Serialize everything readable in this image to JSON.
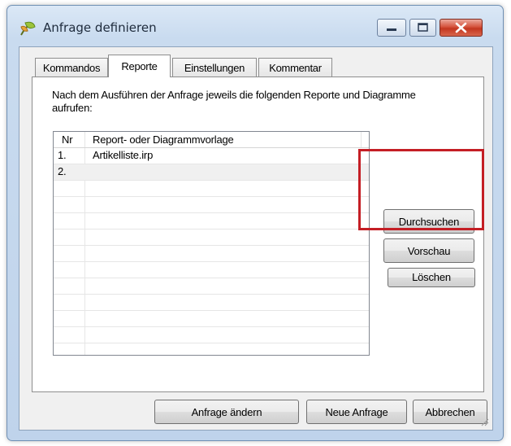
{
  "window": {
    "title": "Anfrage definieren",
    "app_icon": "leaf-icon",
    "caption_buttons": [
      "minimize-icon",
      "maximize-icon",
      "close-icon"
    ]
  },
  "tabs": [
    {
      "label": "Kommandos",
      "active": false
    },
    {
      "label": "Reporte",
      "active": true
    },
    {
      "label": "Einstellungen",
      "active": false
    },
    {
      "label": "Kommentar",
      "active": false
    }
  ],
  "panel": {
    "description": "Nach dem Ausführen der Anfrage jeweils die folgenden Reporte und Diagramme aufrufen:",
    "list": {
      "columns": [
        "Nr",
        "Report- oder Diagrammvorlage"
      ],
      "rows": [
        {
          "nr": "1.",
          "template": "Artikelliste.irp"
        },
        {
          "nr": "2.",
          "template": ""
        }
      ]
    },
    "buttons": {
      "browse": "Durchsuchen",
      "preview": "Vorschau",
      "delete": "Löschen"
    }
  },
  "footer": {
    "change_query": "Anfrage ändern",
    "new_query": "Neue Anfrage",
    "cancel": "Abbrechen"
  },
  "highlight_color": "#c41e25"
}
